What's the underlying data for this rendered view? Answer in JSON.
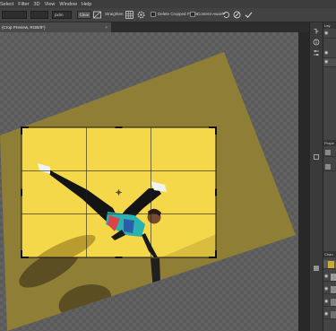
{
  "menu": [
    "Select",
    "Filter",
    "3D",
    "View",
    "Window",
    "Help"
  ],
  "options": {
    "ratio_value": "",
    "unit_value": "px/in",
    "clear_label": "Clear",
    "straighten_label": "Straighten",
    "delete_cropped_label": "Delete Cropped Pixels",
    "content_aware_label": "Content-Aware"
  },
  "document": {
    "tab_title": "(Crop Preview, RGB/8*)",
    "close_symbol": "×"
  },
  "right_toolstrip": {
    "icons": [
      "history-icon",
      "info-icon",
      "adjust-icon"
    ]
  },
  "right_panel": {
    "top_label": "Lay",
    "properties_label": "Prope",
    "channels_label": "Chan"
  },
  "colors": {
    "photo_yellow": "#f4d84a",
    "crop_border": "#111111",
    "canvas_bg": "#282828",
    "ui_dark": "#3c3c3c"
  }
}
